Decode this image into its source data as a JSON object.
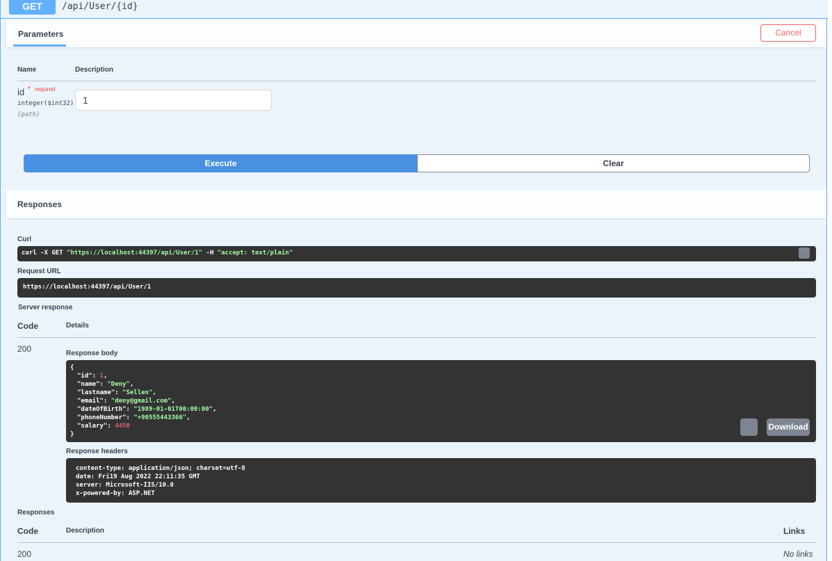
{
  "endpoint": {
    "method": "GET",
    "path": "/api/User/{id}"
  },
  "params": {
    "tab": "Parameters",
    "cancel": "Cancel",
    "col_name": "Name",
    "col_desc": "Description",
    "id": {
      "name": "id",
      "star": "*",
      "required": "required",
      "type": "integer($int32)",
      "in": "(path)",
      "value": "1"
    }
  },
  "actions": {
    "execute": "Execute",
    "clear": "Clear"
  },
  "responses_title": "Responses",
  "curl": {
    "label": "Curl",
    "cmd_pre": "curl -X GET ",
    "url": "\"https://localhost:44397/api/User/1\"",
    "flag": " -H  ",
    "accept": "\"accept: text/plain\""
  },
  "request_url": {
    "label": "Request URL",
    "value": "https://localhost:44397/api/User/1"
  },
  "server_response": {
    "label": "Server response",
    "col_code": "Code",
    "col_details": "Details",
    "code": "200",
    "body_label": "Response body",
    "download": "Download",
    "headers_label": "Response headers",
    "headers": [
      "content-type: application/json; charset=utf-8",
      "date: Fri19 Aug 2022 22:11:35 GMT",
      "server: Microsoft-IIS/10.0",
      "x-powered-by: ASP.NET"
    ]
  },
  "body": {
    "open": "{",
    "close": "}",
    "id_key": "\"id\"",
    "id_val": "1",
    "name_key": "\"name\"",
    "name_val": "\"Deny\"",
    "lastname_key": "\"lastname\"",
    "lastname_val": "\"Sellen\"",
    "email_key": "\"email\"",
    "email_val": "\"deny@gmail.com\"",
    "dob_key": "\"dateOfBirth\"",
    "dob_val": "\"1989-01-01T00:00:00\"",
    "phone_key": "\"phoneNumber\"",
    "phone_val": "\"+90555443366\"",
    "salary_key": "\"salary\"",
    "salary_val": "4450"
  },
  "responses": {
    "label": "Responses",
    "col_code": "Code",
    "col_desc": "Description",
    "col_links": "Links",
    "code": "200",
    "links": "No links"
  },
  "colors": {
    "get": "#61affe",
    "execute": "#4990e2",
    "cancel": "#ff6060"
  }
}
